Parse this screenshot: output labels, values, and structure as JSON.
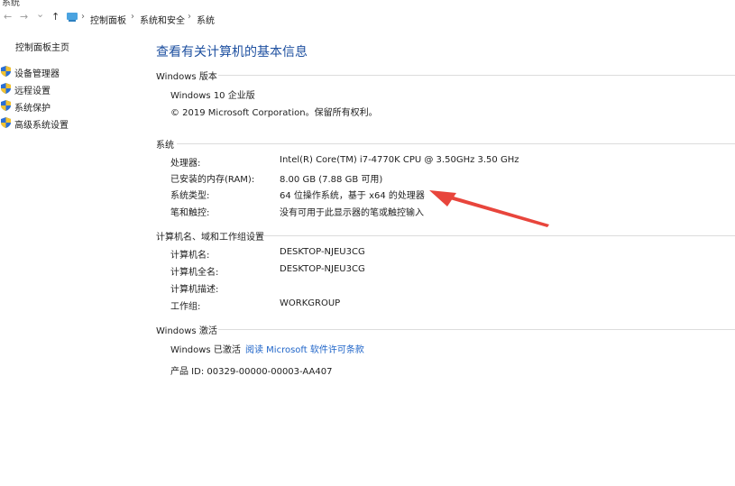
{
  "window": {
    "title_fragment": "系统"
  },
  "nav": {
    "back_glyph": "←",
    "forward_glyph": "→",
    "dropdown_glyph": "⌄",
    "up_glyph": "↑",
    "chevron": "›",
    "breadcrumbs": [
      "控制面板",
      "系统和安全",
      "系统"
    ]
  },
  "sidebar": {
    "home": "控制面板主页",
    "items": [
      {
        "label": "设备管理器",
        "icon": "shield-icon"
      },
      {
        "label": "远程设置",
        "icon": "shield-icon"
      },
      {
        "label": "系统保护",
        "icon": "shield-icon"
      },
      {
        "label": "高级系统设置",
        "icon": "shield-icon"
      }
    ]
  },
  "main": {
    "title": "查看有关计算机的基本信息",
    "windows_edition": {
      "heading": "Windows 版本",
      "edition": "Windows 10 企业版",
      "copyright": "© 2019 Microsoft Corporation。保留所有权利。"
    },
    "system": {
      "heading": "系统",
      "rows": [
        {
          "label": "处理器:",
          "value": "Intel(R) Core(TM) i7-4770K CPU @ 3.50GHz   3.50 GHz"
        },
        {
          "label": "已安装的内存(RAM):",
          "value": "8.00 GB (7.88 GB 可用)"
        },
        {
          "label": "系统类型:",
          "value": "64 位操作系统，基于 x64 的处理器"
        },
        {
          "label": "笔和触控:",
          "value": "没有可用于此显示器的笔或触控输入"
        }
      ]
    },
    "computer_name": {
      "heading": "计算机名、域和工作组设置",
      "rows": [
        {
          "label": "计算机名:",
          "value": "DESKTOP-NJEU3CG"
        },
        {
          "label": "计算机全名:",
          "value": "DESKTOP-NJEU3CG"
        },
        {
          "label": "计算机描述:",
          "value": ""
        },
        {
          "label": "工作组:",
          "value": "WORKGROUP"
        }
      ]
    },
    "activation": {
      "heading": "Windows 激活",
      "status": "Windows 已激活",
      "license_link": "阅读 Microsoft 软件许可条款",
      "product_id": "产品 ID: 00329-00000-00003-AA407"
    }
  },
  "annotation": {
    "arrow_color": "#e8453c"
  },
  "colors": {
    "link": "#1e64c8",
    "title": "#1e50a0",
    "shield_blue": "#2a6fd6",
    "shield_yellow": "#f2c230"
  }
}
